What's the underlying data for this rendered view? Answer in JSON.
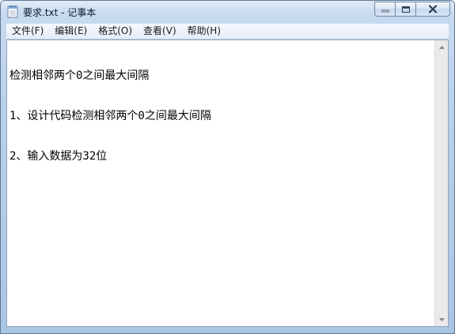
{
  "window": {
    "title": "要求.txt - 记事本",
    "icons": {
      "app": "notepad-icon",
      "minimize": "minimize-icon",
      "maximize": "maximize-icon",
      "close": "close-icon"
    }
  },
  "menubar": {
    "items": [
      {
        "label": "文件(F)"
      },
      {
        "label": "编辑(E)"
      },
      {
        "label": "格式(O)"
      },
      {
        "label": "查看(V)"
      },
      {
        "label": "帮助(H)"
      }
    ]
  },
  "document": {
    "lines": [
      "检测相邻两个0之间最大间隔",
      "1、设计代码检测相邻两个0之间最大间隔",
      "2、输入数据为32位"
    ]
  },
  "scrollbar": {
    "up_icon": "scroll-up-arrow-icon",
    "down_icon": "scroll-down-arrow-icon"
  }
}
